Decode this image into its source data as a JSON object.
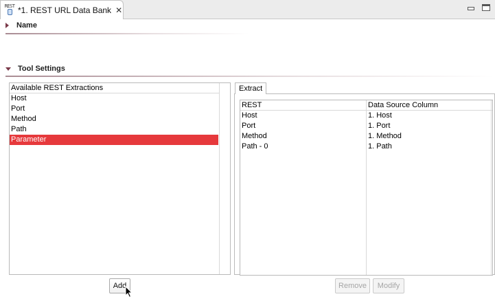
{
  "tab": {
    "icon_text": "REST",
    "title": "*1. REST URL Data Bank",
    "close_glyph": "✕"
  },
  "sections": {
    "name": {
      "label": "Name"
    },
    "tool_settings": {
      "label": "Tool Settings"
    }
  },
  "available_list": {
    "header": "Available REST Extractions",
    "items": [
      "Host",
      "Port",
      "Method",
      "Path",
      "Parameter"
    ],
    "selected_index": 4
  },
  "extract_tab": {
    "label": "Extract"
  },
  "extract_table": {
    "columns": [
      "REST",
      "Data Source Column"
    ],
    "rows": [
      [
        "Host",
        "1. Host"
      ],
      [
        "Port",
        "1. Port"
      ],
      [
        "Method",
        "1. Method"
      ],
      [
        "Path - 0",
        "1. Path"
      ]
    ]
  },
  "buttons": {
    "add": "Add",
    "remove": "Remove",
    "modify": "Modify"
  },
  "colors": {
    "selection": "#e6393c",
    "section_arrow": "#7a3a4a"
  }
}
